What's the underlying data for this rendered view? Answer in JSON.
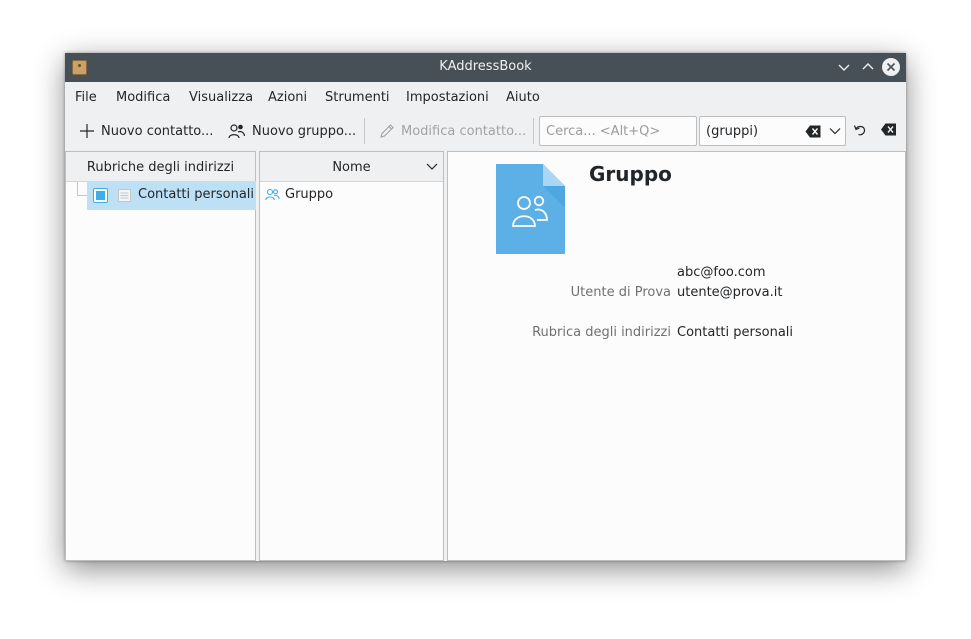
{
  "window": {
    "title": "KAddressBook"
  },
  "menu": [
    "File",
    "Modifica",
    "Visualizza",
    "Azioni",
    "Strumenti",
    "Impostazioni",
    "Aiuto"
  ],
  "toolbar": {
    "new_contact": "Nuovo contatto...",
    "new_group": "Nuovo gruppo...",
    "edit_contact": "Modifica contatto...",
    "search_placeholder": "Cerca... <Alt+Q>",
    "filter_value": "(gruppi)"
  },
  "left_panel": {
    "header": "Rubriche degli indirizzi",
    "items": [
      {
        "label": "Contatti personali",
        "checked": true
      }
    ]
  },
  "middle_panel": {
    "header": "Nome",
    "items": [
      {
        "label": "Gruppo"
      }
    ]
  },
  "detail": {
    "title": "Gruppo",
    "rows": [
      {
        "label": "",
        "value": "abc@foo.com"
      },
      {
        "label": "Utente di Prova",
        "value": "utente@prova.it"
      },
      {
        "label": "Rubrica degli indirizzi",
        "value": "Contatti personali"
      }
    ]
  },
  "colors": {
    "titlebar": "#475057",
    "selection": "#bde0f4",
    "accent": "#3daee9",
    "window_bg": "#eff0f1"
  },
  "icons": [
    "app-icon",
    "chevron-down-icon",
    "chevron-up-icon",
    "close-icon",
    "plus-icon",
    "add-group-icon",
    "pencil-icon",
    "clear-text-icon",
    "undo-icon",
    "address-book-icon",
    "group-icon",
    "group-document-icon"
  ]
}
